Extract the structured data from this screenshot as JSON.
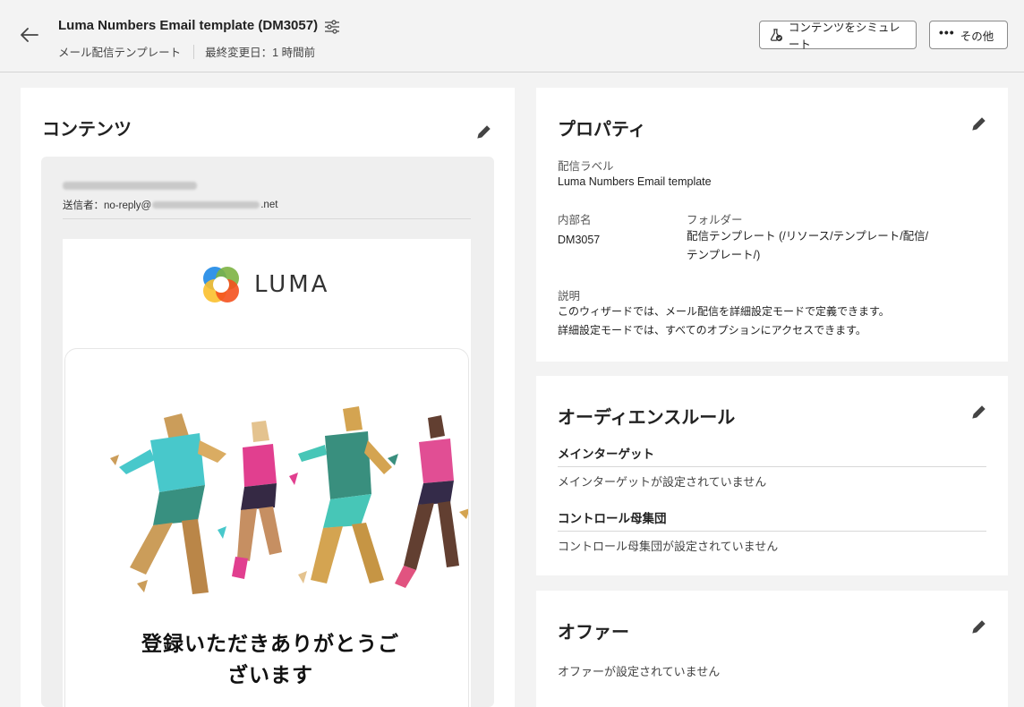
{
  "header": {
    "title": "Luma Numbers Email template (DM3057)",
    "type": "メール配信テンプレート",
    "modified": "最終変更日：1 時間前",
    "simulate_label": "コンテンツをシミュレート",
    "more_label": "その他",
    "more_dots": "•••"
  },
  "content": {
    "title": "コンテンツ",
    "sender_prefix": "送信者：no-reply@",
    "sender_suffix": ".net",
    "logo_text": "LUMA",
    "headline_line1": "登録いただきありがとうご",
    "headline_line2": "ざいます"
  },
  "properties": {
    "title": "プロパティ",
    "delivery_label_heading": "配信ラベル",
    "delivery_label_value": "Luma Numbers Email template",
    "internal_name_heading": "内部名",
    "internal_name_value": "DM3057",
    "folder_heading": "フォルダー",
    "folder_value_line1": "配信テンプレート (/リソース/テンプレート/配信/",
    "folder_value_line2": "テンプレート/)",
    "description_heading": "説明",
    "description_line1": "このウィザードでは、メール配信を詳細設定モードで定義できます。",
    "description_line2": "詳細設定モードでは、すべてのオプションにアクセスできます。"
  },
  "audience": {
    "title": "オーディエンスルール",
    "main_target_heading": "メインターゲット",
    "main_target_value": "メインターゲットが設定されていません",
    "control_heading": "コントロール母集団",
    "control_value": "コントロール母集団が設定されていません"
  },
  "offer": {
    "title": "オファー",
    "value": "オファーが設定されていません"
  },
  "colors": {
    "background": "#f3f3f3",
    "card": "#ffffff",
    "logo_blue": "#1e88e5",
    "logo_green": "#7cb342",
    "logo_yellow": "#fbc02d",
    "logo_orange": "#f4511e"
  }
}
